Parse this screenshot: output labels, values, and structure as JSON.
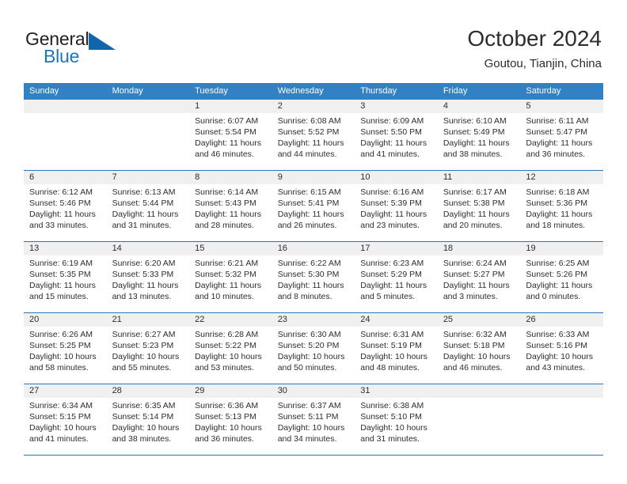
{
  "brand": {
    "name_part1": "General",
    "name_part2": "Blue",
    "logo_icon": "triangle-logo-icon"
  },
  "header": {
    "title": "October 2024",
    "subtitle": "Goutou, Tianjin, China"
  },
  "colors": {
    "header_blue": "#3281c4",
    "row_divider_blue": "#2f75b5",
    "daynum_band": "#f0f0f0",
    "brand_blue": "#1878be",
    "text": "#2d2d2d"
  },
  "weekdays": [
    "Sunday",
    "Monday",
    "Tuesday",
    "Wednesday",
    "Thursday",
    "Friday",
    "Saturday"
  ],
  "labels": {
    "sunrise_prefix": "Sunrise:",
    "sunset_prefix": "Sunset:",
    "daylight_prefix": "Daylight:"
  },
  "weeks": [
    [
      {
        "day": "",
        "sunrise": "",
        "sunset": "",
        "daylight": "",
        "empty": true
      },
      {
        "day": "",
        "sunrise": "",
        "sunset": "",
        "daylight": "",
        "empty": true
      },
      {
        "day": "1",
        "sunrise": "Sunrise: 6:07 AM",
        "sunset": "Sunset: 5:54 PM",
        "daylight": "Daylight: 11 hours and 46 minutes.",
        "empty": false
      },
      {
        "day": "2",
        "sunrise": "Sunrise: 6:08 AM",
        "sunset": "Sunset: 5:52 PM",
        "daylight": "Daylight: 11 hours and 44 minutes.",
        "empty": false
      },
      {
        "day": "3",
        "sunrise": "Sunrise: 6:09 AM",
        "sunset": "Sunset: 5:50 PM",
        "daylight": "Daylight: 11 hours and 41 minutes.",
        "empty": false
      },
      {
        "day": "4",
        "sunrise": "Sunrise: 6:10 AM",
        "sunset": "Sunset: 5:49 PM",
        "daylight": "Daylight: 11 hours and 38 minutes.",
        "empty": false
      },
      {
        "day": "5",
        "sunrise": "Sunrise: 6:11 AM",
        "sunset": "Sunset: 5:47 PM",
        "daylight": "Daylight: 11 hours and 36 minutes.",
        "empty": false
      }
    ],
    [
      {
        "day": "6",
        "sunrise": "Sunrise: 6:12 AM",
        "sunset": "Sunset: 5:46 PM",
        "daylight": "Daylight: 11 hours and 33 minutes.",
        "empty": false
      },
      {
        "day": "7",
        "sunrise": "Sunrise: 6:13 AM",
        "sunset": "Sunset: 5:44 PM",
        "daylight": "Daylight: 11 hours and 31 minutes.",
        "empty": false
      },
      {
        "day": "8",
        "sunrise": "Sunrise: 6:14 AM",
        "sunset": "Sunset: 5:43 PM",
        "daylight": "Daylight: 11 hours and 28 minutes.",
        "empty": false
      },
      {
        "day": "9",
        "sunrise": "Sunrise: 6:15 AM",
        "sunset": "Sunset: 5:41 PM",
        "daylight": "Daylight: 11 hours and 26 minutes.",
        "empty": false
      },
      {
        "day": "10",
        "sunrise": "Sunrise: 6:16 AM",
        "sunset": "Sunset: 5:39 PM",
        "daylight": "Daylight: 11 hours and 23 minutes.",
        "empty": false
      },
      {
        "day": "11",
        "sunrise": "Sunrise: 6:17 AM",
        "sunset": "Sunset: 5:38 PM",
        "daylight": "Daylight: 11 hours and 20 minutes.",
        "empty": false
      },
      {
        "day": "12",
        "sunrise": "Sunrise: 6:18 AM",
        "sunset": "Sunset: 5:36 PM",
        "daylight": "Daylight: 11 hours and 18 minutes.",
        "empty": false
      }
    ],
    [
      {
        "day": "13",
        "sunrise": "Sunrise: 6:19 AM",
        "sunset": "Sunset: 5:35 PM",
        "daylight": "Daylight: 11 hours and 15 minutes.",
        "empty": false
      },
      {
        "day": "14",
        "sunrise": "Sunrise: 6:20 AM",
        "sunset": "Sunset: 5:33 PM",
        "daylight": "Daylight: 11 hours and 13 minutes.",
        "empty": false
      },
      {
        "day": "15",
        "sunrise": "Sunrise: 6:21 AM",
        "sunset": "Sunset: 5:32 PM",
        "daylight": "Daylight: 11 hours and 10 minutes.",
        "empty": false
      },
      {
        "day": "16",
        "sunrise": "Sunrise: 6:22 AM",
        "sunset": "Sunset: 5:30 PM",
        "daylight": "Daylight: 11 hours and 8 minutes.",
        "empty": false
      },
      {
        "day": "17",
        "sunrise": "Sunrise: 6:23 AM",
        "sunset": "Sunset: 5:29 PM",
        "daylight": "Daylight: 11 hours and 5 minutes.",
        "empty": false
      },
      {
        "day": "18",
        "sunrise": "Sunrise: 6:24 AM",
        "sunset": "Sunset: 5:27 PM",
        "daylight": "Daylight: 11 hours and 3 minutes.",
        "empty": false
      },
      {
        "day": "19",
        "sunrise": "Sunrise: 6:25 AM",
        "sunset": "Sunset: 5:26 PM",
        "daylight": "Daylight: 11 hours and 0 minutes.",
        "empty": false
      }
    ],
    [
      {
        "day": "20",
        "sunrise": "Sunrise: 6:26 AM",
        "sunset": "Sunset: 5:25 PM",
        "daylight": "Daylight: 10 hours and 58 minutes.",
        "empty": false
      },
      {
        "day": "21",
        "sunrise": "Sunrise: 6:27 AM",
        "sunset": "Sunset: 5:23 PM",
        "daylight": "Daylight: 10 hours and 55 minutes.",
        "empty": false
      },
      {
        "day": "22",
        "sunrise": "Sunrise: 6:28 AM",
        "sunset": "Sunset: 5:22 PM",
        "daylight": "Daylight: 10 hours and 53 minutes.",
        "empty": false
      },
      {
        "day": "23",
        "sunrise": "Sunrise: 6:30 AM",
        "sunset": "Sunset: 5:20 PM",
        "daylight": "Daylight: 10 hours and 50 minutes.",
        "empty": false
      },
      {
        "day": "24",
        "sunrise": "Sunrise: 6:31 AM",
        "sunset": "Sunset: 5:19 PM",
        "daylight": "Daylight: 10 hours and 48 minutes.",
        "empty": false
      },
      {
        "day": "25",
        "sunrise": "Sunrise: 6:32 AM",
        "sunset": "Sunset: 5:18 PM",
        "daylight": "Daylight: 10 hours and 46 minutes.",
        "empty": false
      },
      {
        "day": "26",
        "sunrise": "Sunrise: 6:33 AM",
        "sunset": "Sunset: 5:16 PM",
        "daylight": "Daylight: 10 hours and 43 minutes.",
        "empty": false
      }
    ],
    [
      {
        "day": "27",
        "sunrise": "Sunrise: 6:34 AM",
        "sunset": "Sunset: 5:15 PM",
        "daylight": "Daylight: 10 hours and 41 minutes.",
        "empty": false
      },
      {
        "day": "28",
        "sunrise": "Sunrise: 6:35 AM",
        "sunset": "Sunset: 5:14 PM",
        "daylight": "Daylight: 10 hours and 38 minutes.",
        "empty": false
      },
      {
        "day": "29",
        "sunrise": "Sunrise: 6:36 AM",
        "sunset": "Sunset: 5:13 PM",
        "daylight": "Daylight: 10 hours and 36 minutes.",
        "empty": false
      },
      {
        "day": "30",
        "sunrise": "Sunrise: 6:37 AM",
        "sunset": "Sunset: 5:11 PM",
        "daylight": "Daylight: 10 hours and 34 minutes.",
        "empty": false
      },
      {
        "day": "31",
        "sunrise": "Sunrise: 6:38 AM",
        "sunset": "Sunset: 5:10 PM",
        "daylight": "Daylight: 10 hours and 31 minutes.",
        "empty": false
      },
      {
        "day": "",
        "sunrise": "",
        "sunset": "",
        "daylight": "",
        "empty": true
      },
      {
        "day": "",
        "sunrise": "",
        "sunset": "",
        "daylight": "",
        "empty": true
      }
    ]
  ]
}
